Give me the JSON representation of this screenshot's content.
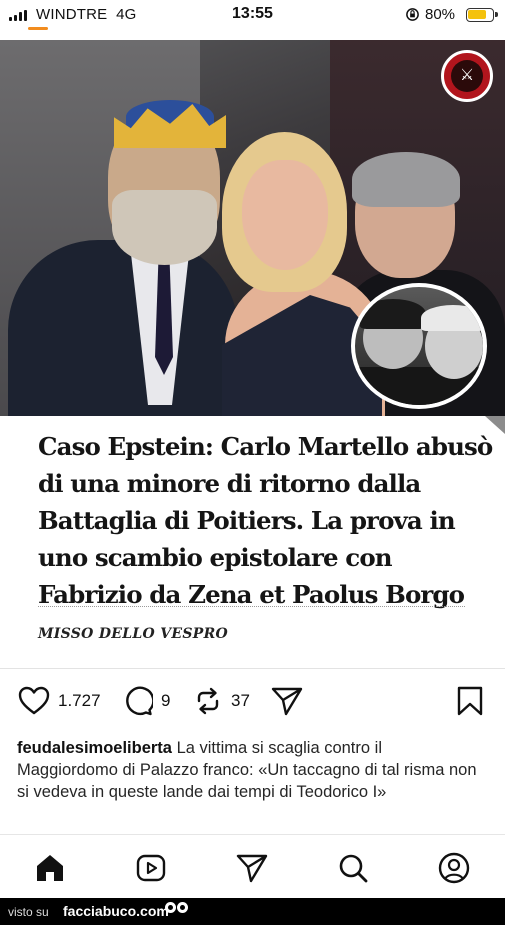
{
  "status_bar": {
    "carrier": "WINDTRE",
    "network": "4G",
    "time": "13:55",
    "battery_percent": "80%",
    "battery_level": 0.8,
    "battery_color": "#f4c20d",
    "lock_icon": "orientation-lock-icon"
  },
  "post": {
    "image_description_icons": [
      "king-crown-overlay",
      "logo-badge",
      "inset-photo"
    ],
    "headline": "Caso Epstein: Carlo Martello abusò di una minore di ritorno dalla Battaglia di Poitiers. La prova in uno scambio epistolare con Fabrizio da Zena et Paolus Borgo",
    "source": "MISSO DELLO VESPRO",
    "likes": "1.727",
    "comments": "9",
    "reposts": "37",
    "caption_user": "feudalesimoeliberta",
    "caption_text": " La vittima si scaglia contro il Maggiordomo di Palazzo franco: «Un taccagno di tal risma non si vedeva in queste lande dai tempi di Teodorico I»"
  },
  "nav": {
    "items": [
      "home-icon",
      "reels-icon",
      "send-icon",
      "search-icon",
      "profile-icon"
    ]
  },
  "watermark": {
    "prefix": "visto su",
    "site": "facciabuco.com"
  }
}
